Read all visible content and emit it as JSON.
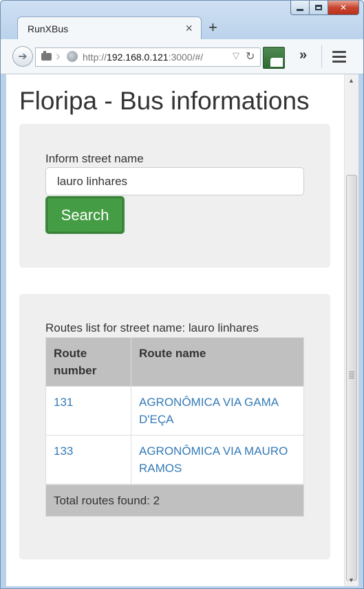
{
  "browser": {
    "tab_title": "RunXBus",
    "tab_close": "×",
    "new_tab": "+",
    "url_prefix": "http://",
    "url_host": "192.168.0.121",
    "url_rest": ":3000/#/",
    "overflow": "»"
  },
  "page": {
    "title": "Floripa - Bus informations"
  },
  "search": {
    "label": "Inform street name",
    "input_value": "lauro linhares",
    "button_label": "Search"
  },
  "results": {
    "label": "Routes list for street name: lauro linhares",
    "columns": [
      "Route number",
      "Route name"
    ],
    "rows": [
      {
        "number": "131",
        "name": "AGRONÔMICA VIA GAMA D'EÇA"
      },
      {
        "number": "133",
        "name": "AGRONÔMICA VIA MAURO RAMOS"
      }
    ],
    "footer": "Total routes found: 2"
  },
  "colors": {
    "search_button": "#449d44",
    "link": "#337ab7",
    "table_header": "#c0c0c0",
    "well_background": "#efefef"
  }
}
